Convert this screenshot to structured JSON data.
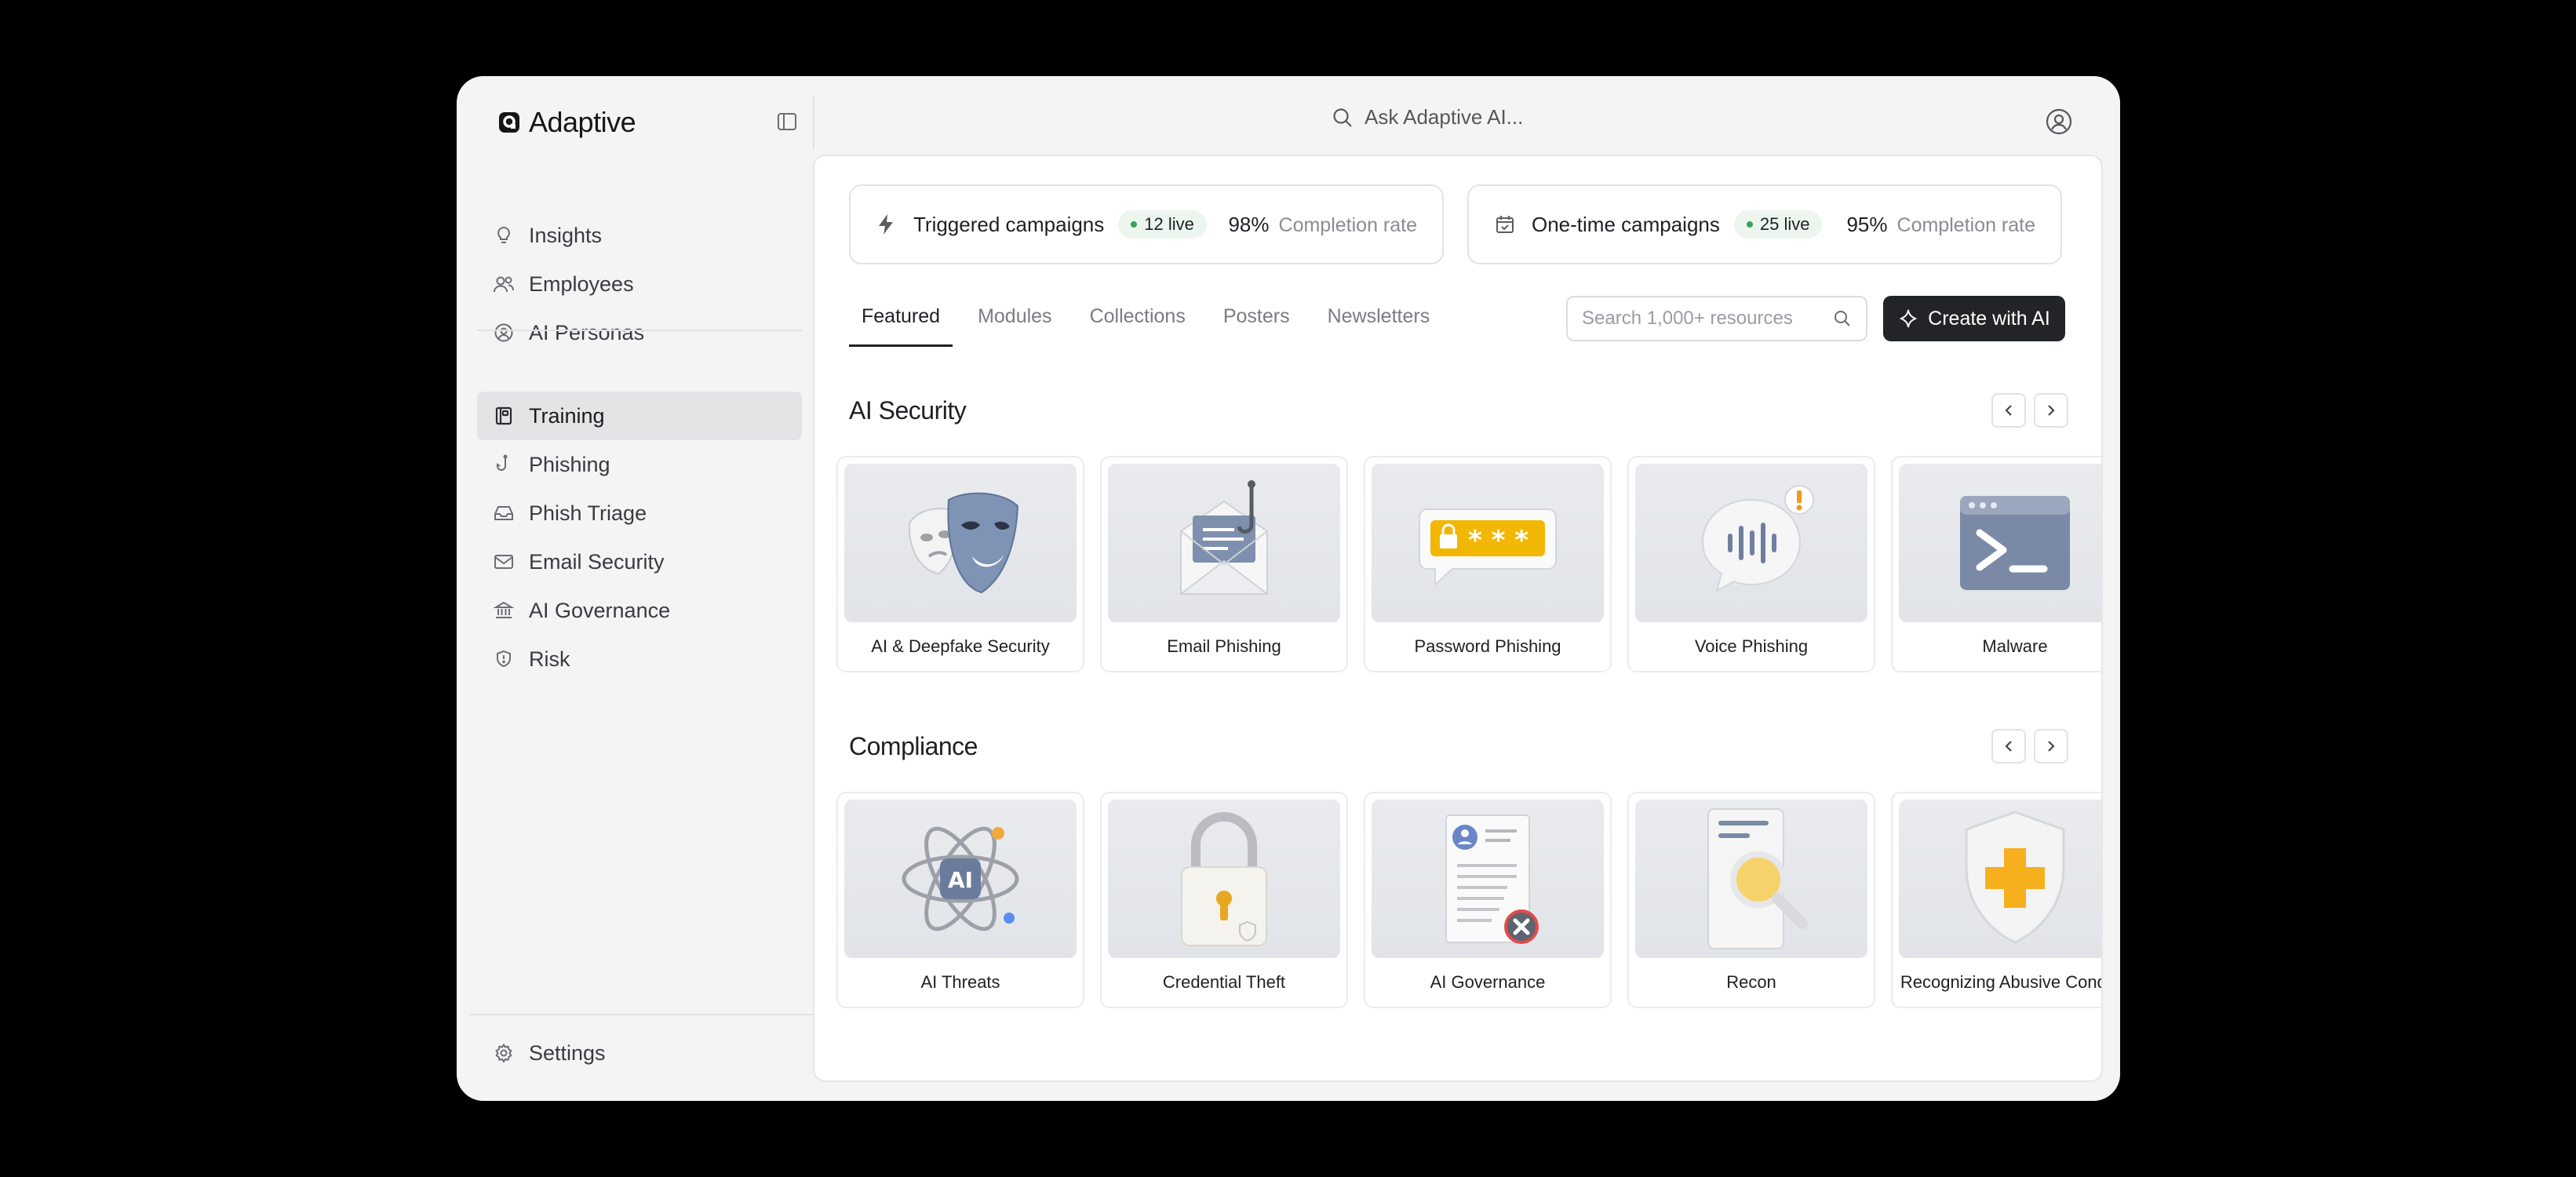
{
  "brand": {
    "name": "Adaptive"
  },
  "search_bar": {
    "placeholder": "Ask Adaptive AI..."
  },
  "sidebar": {
    "group1": [
      {
        "label": "Insights",
        "icon": "lightbulb-icon"
      },
      {
        "label": "Employees",
        "icon": "users-icon"
      },
      {
        "label": "AI Personas",
        "icon": "persona-icon"
      }
    ],
    "group2": [
      {
        "label": "Training",
        "icon": "book-icon",
        "active": true
      },
      {
        "label": "Phishing",
        "icon": "hook-icon"
      },
      {
        "label": "Phish Triage",
        "icon": "inbox-icon"
      },
      {
        "label": "Email Security",
        "icon": "mail-icon"
      },
      {
        "label": "AI Governance",
        "icon": "bank-icon"
      },
      {
        "label": "Risk",
        "icon": "shield-icon"
      }
    ],
    "settings": {
      "label": "Settings",
      "icon": "gear-icon"
    }
  },
  "campaigns": [
    {
      "title": "Triggered campaigns",
      "live": "12 live",
      "pct": "98%",
      "rate_label": "Completion rate",
      "icon": "bolt-icon"
    },
    {
      "title": "One-time campaigns",
      "live": "25 live",
      "pct": "95%",
      "rate_label": "Completion rate",
      "icon": "calendar-icon"
    }
  ],
  "tabs": [
    "Featured",
    "Modules",
    "Collections",
    "Posters",
    "Newsletters"
  ],
  "resource_search": {
    "placeholder": "Search 1,000+ resources"
  },
  "create_button": {
    "label": "Create with AI"
  },
  "sections": [
    {
      "title": "AI Security",
      "cards": [
        {
          "label": "AI & Deepfake Security",
          "icon": "masks-icon"
        },
        {
          "label": "Email Phishing",
          "icon": "envelope-hook-icon"
        },
        {
          "label": "Password Phishing",
          "icon": "password-bubble-icon"
        },
        {
          "label": "Voice Phishing",
          "icon": "voice-bubble-icon"
        },
        {
          "label": "Malware",
          "icon": "terminal-icon"
        }
      ]
    },
    {
      "title": "Compliance",
      "cards": [
        {
          "label": "AI Threats",
          "icon": "atom-icon"
        },
        {
          "label": "Credential Theft",
          "icon": "padlock-icon"
        },
        {
          "label": "AI Governance",
          "icon": "document-x-icon"
        },
        {
          "label": "Recon",
          "icon": "magnifier-doc-icon"
        },
        {
          "label": "Recognizing Abusive Conduct",
          "icon": "shield-plus-icon"
        }
      ]
    }
  ],
  "colors": {
    "accent_dark": "#232427",
    "live_green": "#33a35a",
    "active_bg": "#e4e4e6"
  }
}
